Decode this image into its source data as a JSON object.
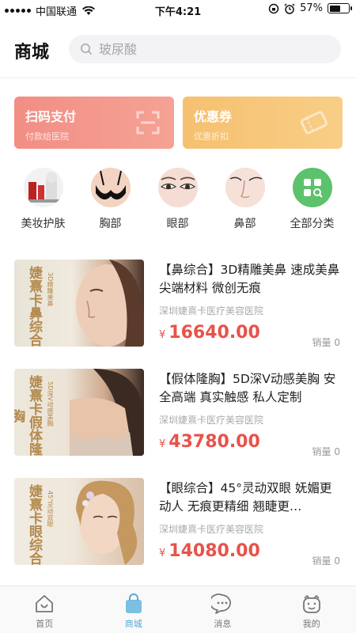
{
  "status": {
    "carrier": "中国联通",
    "time": "下午4:21",
    "battery": "57%",
    "battery_level": 0.57
  },
  "header": {
    "title": "商城",
    "search_placeholder": "玻尿酸"
  },
  "cards": [
    {
      "title": "扫码支付",
      "subtitle": "付款给医院",
      "icon": "scan-icon"
    },
    {
      "title": "优惠券",
      "subtitle": "优惠折扣",
      "icon": "ticket-icon"
    }
  ],
  "categories": [
    {
      "label": "美妆护肤",
      "icon": "skincare-icon"
    },
    {
      "label": "胸部",
      "icon": "chest-icon"
    },
    {
      "label": "眼部",
      "icon": "eye-icon"
    },
    {
      "label": "鼻部",
      "icon": "nose-icon"
    },
    {
      "label": "全部分类",
      "icon": "grid-search-icon"
    }
  ],
  "products": [
    {
      "title": "【鼻综合】3D精雕美鼻 速成美鼻 尖端材料 微创无痕",
      "shop": "深圳婕熹卡医疗美容医院",
      "currency": "¥",
      "price": "16640.00",
      "sales": "销量 0",
      "thumb_text": "婕熹卡鼻综合",
      "thumb_sub": "3D精雕美鼻"
    },
    {
      "title": "【假体隆胸】5D深V动感美胸 安全高端 真实触感 私人定制",
      "shop": "深圳婕熹卡医疗美容医院",
      "currency": "¥",
      "price": "43780.00",
      "sales": "销量 0",
      "thumb_text": "婕熹卡假体隆胸",
      "thumb_sub": "5D深V动感美胸"
    },
    {
      "title": "【眼综合】45°灵动双眼 妩媚更动人 无痕更精细 翘睫更…",
      "shop": "深圳婕熹卡医疗美容医院",
      "currency": "¥",
      "price": "14080.00",
      "sales": "销量 0",
      "thumb_text": "婕熹卡眼综合",
      "thumb_sub": "45°灵动双眼"
    }
  ],
  "tabbar": [
    {
      "label": "首页",
      "icon": "home-icon"
    },
    {
      "label": "商城",
      "icon": "shopping-bag-icon",
      "active": true
    },
    {
      "label": "消息",
      "icon": "message-icon"
    },
    {
      "label": "我的",
      "icon": "profile-icon"
    }
  ],
  "colors": {
    "accent": "#5aa8d6",
    "price": "#e8524a",
    "pay_card": "#f28e84",
    "coupon_card": "#f6c070"
  }
}
